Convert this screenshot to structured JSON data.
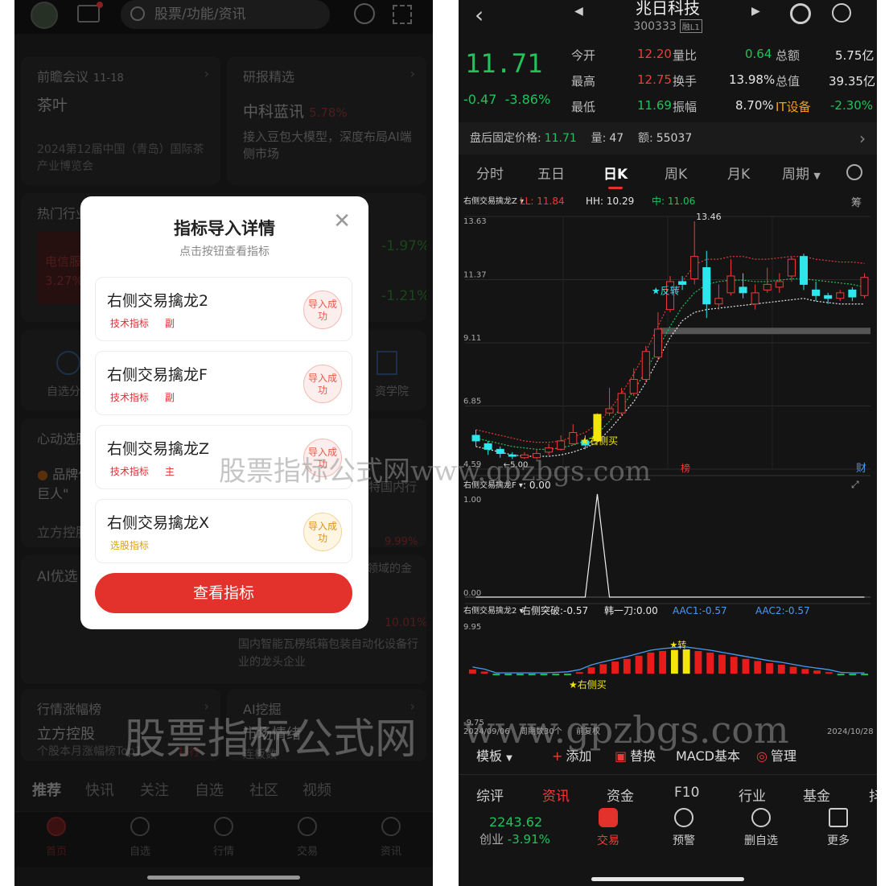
{
  "left": {
    "search_placeholder": "股票/功能/资讯",
    "cards": {
      "meeting": {
        "title": "前瞻会议",
        "date": "11-18",
        "big": "茶叶",
        "desc": "2024第12届中国（青岛）国际茶产业博览会"
      },
      "research": {
        "title": "研报精选",
        "stock": "中科蓝讯",
        "pct": "5.78%",
        "desc": "接入豆包大模型，深度布局AI端侧市场"
      },
      "hot": {
        "title": "热门行业",
        "item": "电信服",
        "pct": "3.27%",
        "right1": "-1.97%",
        "right2": "-1.21%"
      },
      "tools": {
        "left": "自选分",
        "right": "资学院"
      },
      "heart": {
        "title": "心动选股",
        "brand": "品牌代",
        "brand2": "巨人\"",
        "right": "特国内行",
        "lifang": "立方控股"
      },
      "ai": {
        "title": "AI优选",
        "pct1": "9.99%",
        "txt1": "领域的金",
        "pct2": "10.01%",
        "desc": "国内智能瓦楞纸箱包装自动化设备行业的龙头企业"
      },
      "rank": {
        "title": "行情涨幅榜",
        "big": "立方控股",
        "desc": "个股本月涨幅榜Top1",
        "tag": "排行"
      },
      "dig": {
        "title": "AI挖掘",
        "big": "市场情绪",
        "sub": "连板数"
      }
    },
    "tabs": [
      "推荐",
      "快讯",
      "关注",
      "自选",
      "社区",
      "视频"
    ],
    "nav": [
      "首页",
      "自选",
      "行情",
      "交易",
      "资讯"
    ],
    "modal": {
      "title": "指标导入详情",
      "subtitle": "点击按钮查看指标",
      "items": [
        {
          "name": "右侧交易擒龙2",
          "type": "技术指标",
          "level": "副",
          "status": "导入成功"
        },
        {
          "name": "右侧交易擒龙F",
          "type": "技术指标",
          "level": "副",
          "status": "导入成功"
        },
        {
          "name": "右侧交易擒龙Z",
          "type": "技术指标",
          "level": "主",
          "status": "导入成功"
        },
        {
          "name": "右侧交易擒龙X",
          "type": "选股指标",
          "level": "",
          "status": "导入成功"
        }
      ],
      "button": "查看指标"
    }
  },
  "right": {
    "stock_name": "兆日科技",
    "stock_code": "300333",
    "stock_tag": "融L1",
    "price": "11.71",
    "change": "-0.47",
    "change_pct": "-3.86%",
    "stats": [
      {
        "label": "今开",
        "value": "12.20",
        "color": "#f03a3a"
      },
      {
        "label": "最高",
        "value": "12.75",
        "color": "#f03a3a"
      },
      {
        "label": "最低",
        "value": "11.69",
        "color": "#21c25b"
      },
      {
        "label": "量比",
        "value": "0.64",
        "color": "#21c25b"
      },
      {
        "label": "换手",
        "value": "13.98%",
        "color": "#e6e6e6"
      },
      {
        "label": "振幅",
        "value": "8.70%",
        "color": "#e6e6e6"
      },
      {
        "label": "总额",
        "value": "5.75亿",
        "color": "#e6e6e6"
      },
      {
        "label": "总值",
        "value": "39.35亿",
        "color": "#e6e6e6"
      },
      {
        "label": "IT设备",
        "value": "-2.30%",
        "color": "#21c25b"
      }
    ],
    "post": {
      "label": "盘后固定价格:",
      "price": "11.71",
      "vol_label": "量:",
      "vol": "47",
      "amt_label": "额:",
      "amt": "55037"
    },
    "periods": [
      "分时",
      "五日",
      "日K",
      "周K",
      "月K",
      "周期"
    ],
    "toolbar": [
      "模板",
      "添加",
      "替换",
      "MACD基本",
      "管理"
    ],
    "tabs": [
      "综评",
      "资讯",
      "资金",
      "F10",
      "行业",
      "基金",
      "抖"
    ],
    "bottom": {
      "index_value": "2243.62",
      "index_label": "创业",
      "index_pct": "-3.91%",
      "items": [
        "交易",
        "预警",
        "删自选",
        "更多"
      ]
    }
  },
  "chart_data": {
    "type": "candlestick",
    "main": {
      "indicator_name": "右侧交易擒龙Z",
      "legend": [
        {
          "label": "LL",
          "value": "11.84",
          "color": "#f03a3a"
        },
        {
          "label": "HH",
          "value": "10.29",
          "color": "#e6e6e6"
        },
        {
          "label": "中",
          "value": "11.06",
          "color": "#21c25b"
        }
      ],
      "y_labels": [
        "13.63",
        "11.37",
        "9.11",
        "6.85",
        "4.59"
      ],
      "ylim": [
        4.59,
        13.63
      ],
      "max_label": "13.46",
      "min_label": "5.00",
      "annotations": [
        "反转",
        "右侧买"
      ],
      "side_tags": [
        "筹",
        "榜",
        "财"
      ],
      "candles": [
        {
          "o": 5.8,
          "c": 5.6,
          "h": 6.0,
          "l": 5.4
        },
        {
          "o": 5.5,
          "c": 5.3,
          "h": 5.6,
          "l": 5.1
        },
        {
          "o": 5.3,
          "c": 5.15,
          "h": 5.4,
          "l": 5.0
        },
        {
          "o": 5.1,
          "c": 5.05,
          "h": 5.2,
          "l": 4.95
        },
        {
          "o": 5.0,
          "c": 5.1,
          "h": 5.2,
          "l": 4.95
        },
        {
          "o": 5.0,
          "c": 5.15,
          "h": 5.3,
          "l": 4.95
        },
        {
          "o": 5.2,
          "c": 5.35,
          "h": 5.5,
          "l": 5.1
        },
        {
          "o": 5.3,
          "c": 5.6,
          "h": 5.8,
          "l": 5.25
        },
        {
          "o": 5.5,
          "c": 5.9,
          "h": 6.2,
          "l": 5.45
        },
        {
          "o": 5.6,
          "c": 5.45,
          "h": 5.8,
          "l": 5.3
        },
        {
          "o": 5.6,
          "c": 6.55,
          "h": 6.6,
          "l": 5.55
        },
        {
          "o": 6.6,
          "c": 6.75,
          "h": 7.5,
          "l": 6.5
        },
        {
          "o": 6.6,
          "c": 7.3,
          "h": 7.5,
          "l": 6.5
        },
        {
          "o": 7.3,
          "c": 7.8,
          "h": 8.2,
          "l": 7.2
        },
        {
          "o": 7.8,
          "c": 8.8,
          "h": 9.0,
          "l": 7.7
        },
        {
          "o": 8.6,
          "c": 9.6,
          "h": 10.2,
          "l": 8.5
        },
        {
          "o": 10.3,
          "c": 11.3,
          "h": 11.5,
          "l": 10.2
        },
        {
          "o": 11.3,
          "c": 11.2,
          "h": 11.5,
          "l": 11.0
        },
        {
          "o": 11.4,
          "c": 12.2,
          "h": 13.46,
          "l": 11.2
        },
        {
          "o": 11.8,
          "c": 10.5,
          "h": 12.4,
          "l": 10.0
        },
        {
          "o": 10.5,
          "c": 10.7,
          "h": 11.2,
          "l": 10.3
        },
        {
          "o": 10.9,
          "c": 11.5,
          "h": 12.1,
          "l": 10.8
        },
        {
          "o": 11.1,
          "c": 10.9,
          "h": 11.6,
          "l": 10.7
        },
        {
          "o": 10.5,
          "c": 10.9,
          "h": 11.2,
          "l": 10.3
        },
        {
          "o": 11.0,
          "c": 11.2,
          "h": 11.8,
          "l": 10.9
        },
        {
          "o": 11.1,
          "c": 11.3,
          "h": 11.6,
          "l": 10.9
        },
        {
          "o": 11.5,
          "c": 12.1,
          "h": 12.2,
          "l": 11.3
        },
        {
          "o": 12.2,
          "c": 11.2,
          "h": 12.3,
          "l": 11.0
        },
        {
          "o": 11.0,
          "c": 10.8,
          "h": 11.3,
          "l": 10.6
        },
        {
          "o": 10.8,
          "c": 10.7,
          "h": 10.9,
          "l": 10.5
        },
        {
          "o": 10.7,
          "c": 10.9,
          "h": 11.0,
          "l": 10.6
        },
        {
          "o": 11.0,
          "c": 10.75,
          "h": 11.1,
          "l": 10.6
        },
        {
          "o": 10.8,
          "c": 11.45,
          "h": 11.6,
          "l": 10.7
        }
      ],
      "line_top": [
        6.0,
        5.9,
        5.8,
        5.7,
        5.6,
        5.55,
        5.55,
        5.6,
        5.75,
        5.9,
        6.2,
        6.7,
        7.3,
        8.0,
        8.8,
        9.7,
        10.6,
        11.3,
        11.9,
        12.1,
        12.1,
        12.2,
        12.2,
        12.1,
        12.1,
        12.15,
        12.2,
        12.2,
        12.1,
        12.05,
        12.0,
        12.0,
        11.95
      ],
      "line_mid": [
        5.7,
        5.6,
        5.5,
        5.4,
        5.35,
        5.3,
        5.3,
        5.35,
        5.45,
        5.6,
        5.85,
        6.3,
        6.8,
        7.4,
        8.1,
        8.9,
        9.7,
        10.4,
        10.9,
        11.2,
        11.3,
        11.35,
        11.35,
        11.3,
        11.3,
        11.35,
        11.4,
        11.4,
        11.35,
        11.3,
        11.25,
        11.2,
        11.1
      ],
      "line_low": [
        5.4,
        5.3,
        5.2,
        5.1,
        5.05,
        5.05,
        5.05,
        5.1,
        5.2,
        5.35,
        5.55,
        6.0,
        6.5,
        7.0,
        7.7,
        8.5,
        9.3,
        9.9,
        10.2,
        10.3,
        10.35,
        10.4,
        10.45,
        10.5,
        10.55,
        10.6,
        10.65,
        10.7,
        10.6,
        10.55,
        10.5,
        10.5,
        10.5
      ]
    },
    "sub1": {
      "label": "右侧交易擒龙F",
      "value": "0.00",
      "y_labels": [
        "1.00",
        "0.00"
      ],
      "ylim": [
        0,
        1
      ],
      "values": [
        0,
        0,
        0,
        0,
        0,
        0,
        0,
        0,
        0,
        0,
        0,
        0,
        0,
        0,
        0,
        0,
        0,
        0,
        0,
        0,
        0,
        0,
        0,
        0,
        0,
        0,
        0,
        0,
        0,
        0,
        0,
        0,
        0
      ],
      "spike_index": 10
    },
    "sub2": {
      "label": "右侧交易擒龙2",
      "legend": [
        {
          "label": "右侧突破",
          "value": "-0.57",
          "color": "#e6e6e6"
        },
        {
          "label": "韩一刀",
          "value": "0.00",
          "color": "#e6e6e6"
        },
        {
          "label": "AAC1",
          "value": "-0.57",
          "color": "#4a9af0"
        },
        {
          "label": "AAC2",
          "value": "-0.57",
          "color": "#4a9af0"
        }
      ],
      "y_labels": [
        "9.95",
        "-9.75"
      ],
      "ylim": [
        -9.75,
        9.95
      ],
      "annotations": [
        "右侧买",
        "转"
      ],
      "bars": [
        0.8,
        0.4,
        -0.3,
        -0.3,
        -0.3,
        -0.3,
        -0.3,
        -0.2,
        -0.1,
        0.3,
        1.2,
        1.8,
        2.3,
        2.8,
        3.4,
        4.0,
        4.3,
        4.5,
        4.6,
        4.3,
        4.0,
        3.6,
        3.2,
        2.8,
        2.4,
        2.0,
        1.7,
        1.3,
        0.9,
        0.6,
        0.3,
        -0.2,
        -0.3,
        -0.3
      ],
      "highlight": [
        17,
        18
      ]
    },
    "x_labels": [
      "2024/09/06",
      "周期数30个",
      "前复权",
      "2024/10/28"
    ]
  }
}
